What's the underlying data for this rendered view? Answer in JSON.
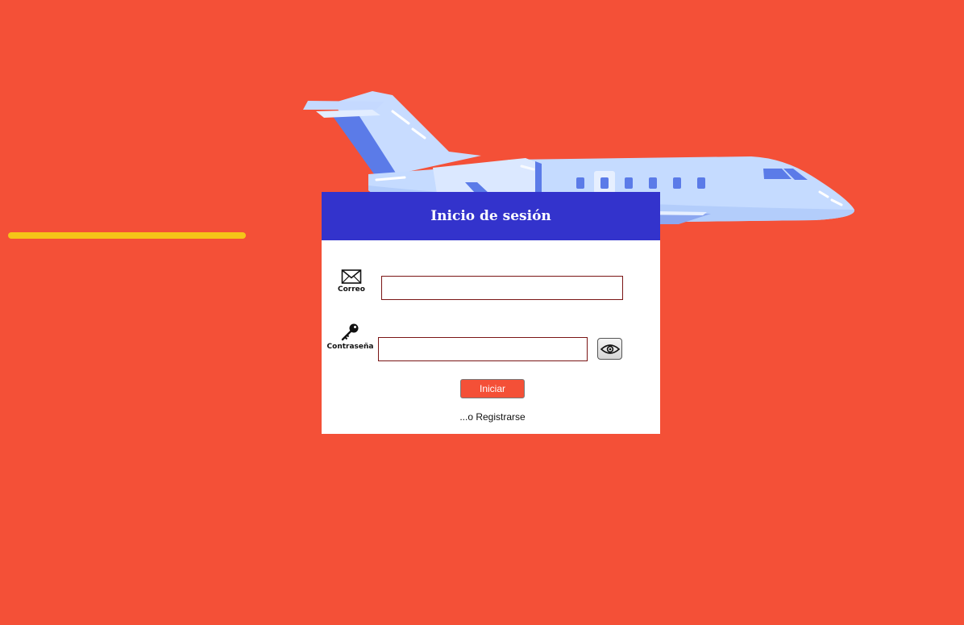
{
  "page": {
    "background_color": "#f45037",
    "accent_line_color": "#f5c518"
  },
  "login": {
    "title": "Inicio de sesión",
    "header_color": "#3333cc",
    "email": {
      "label": "Correo",
      "icon": "envelope-icon",
      "value": "",
      "placeholder": ""
    },
    "password": {
      "label": "Contraseña",
      "icon": "key-icon",
      "value": "",
      "placeholder": "",
      "toggle_icon": "eye-icon"
    },
    "submit_label": "Iniciar",
    "submit_color": "#f45037",
    "register_link": "...o Registrarse"
  },
  "illustration": {
    "subject": "airplane-illustration",
    "body_color": "#c5dbff",
    "accent_color": "#5b7be8"
  }
}
